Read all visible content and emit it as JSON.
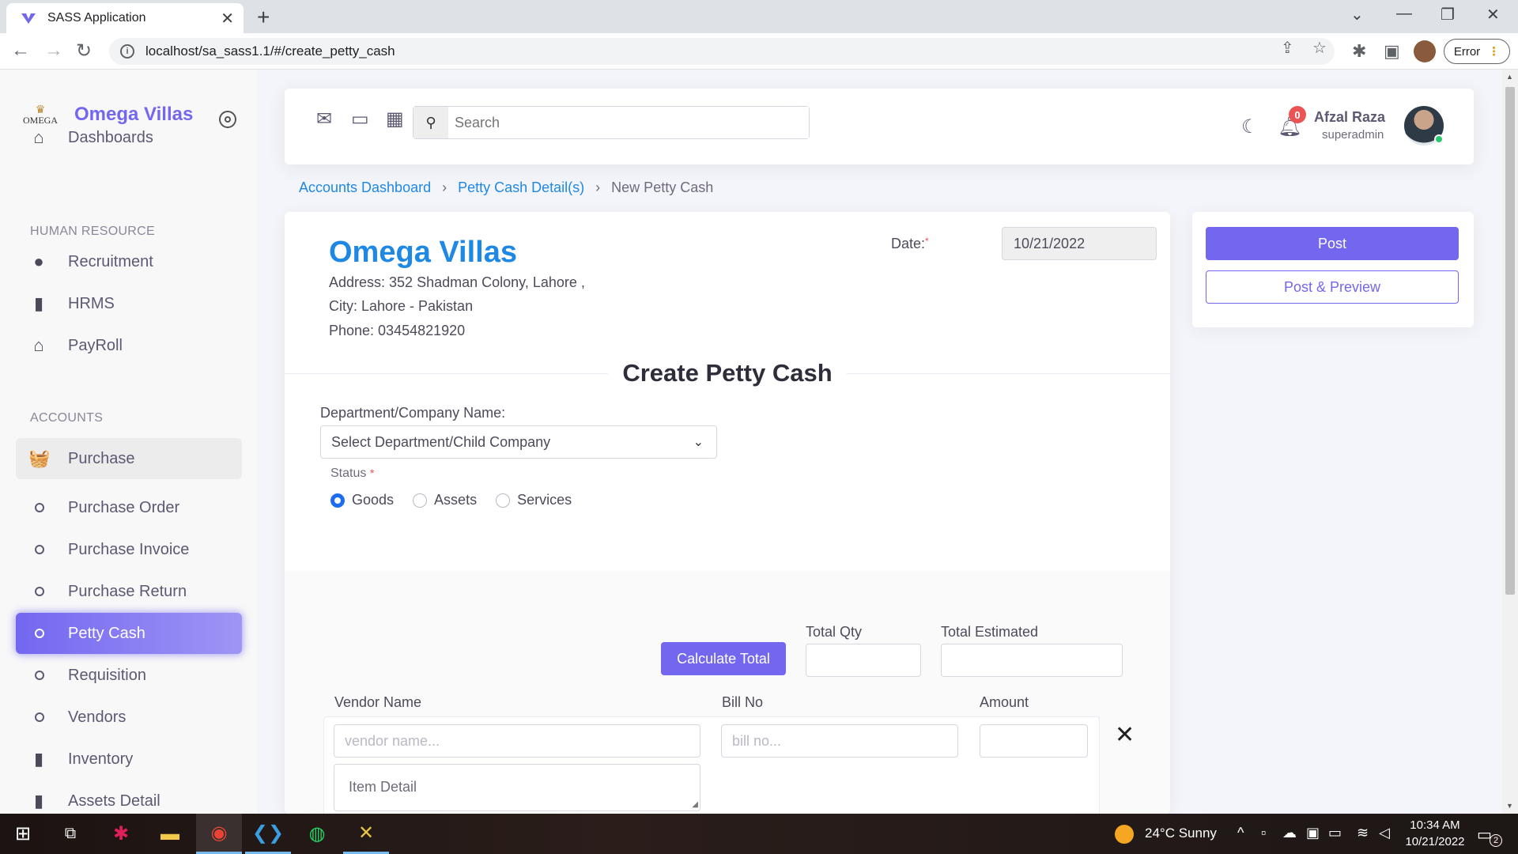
{
  "browser": {
    "tab_title": "SASS Application",
    "tab_close": "✕",
    "new_tab": "+",
    "url": "localhost/sa_sass1.1/#/create_petty_cash",
    "error_label": "Error",
    "minimize": "—",
    "maximize": "❐",
    "close": "✕",
    "tab_menu": "⌄"
  },
  "sidebar": {
    "brand_logo_text": "OMEGA",
    "brand_name": "Omega Villas",
    "dashboards": "Dashboards",
    "hr_header": "HUMAN RESOURCE",
    "hr_items": [
      {
        "label": "Recruitment",
        "icon": "user-icon"
      },
      {
        "label": "HRMS",
        "icon": "file-icon"
      },
      {
        "label": "PayRoll",
        "icon": "bank-icon"
      }
    ],
    "accounts_header": "ACCOUNTS",
    "purchase": "Purchase",
    "sub_items": [
      "Purchase Order",
      "Purchase Invoice",
      "Purchase Return",
      "Petty Cash",
      "Requisition",
      "Vendors"
    ],
    "inventory": "Inventory",
    "assets_detail": "Assets Detail",
    "active_item": "Petty Cash"
  },
  "topnav": {
    "search_placeholder": "Search",
    "notification_count": "0",
    "user_name": "Afzal Raza",
    "user_role": "superadmin"
  },
  "breadcrumb": {
    "items": [
      "Accounts Dashboard",
      "Petty Cash Detail(s)"
    ],
    "current": "New Petty Cash",
    "separator": "›"
  },
  "company": {
    "name": "Omega Villas",
    "address": "Address: 352 Shadman Colony, Lahore ,",
    "city": "City: Lahore - Pakistan",
    "phone": "Phone: 03454821920"
  },
  "form": {
    "date_label": "Date:",
    "date_required": "*",
    "date_value": "10/21/2022",
    "title": "Create Petty Cash",
    "dept_label": "Department/Company Name:",
    "dept_selected": "Select Department/Child Company",
    "status_label": "Status",
    "status_required": "*",
    "status_options": [
      "Goods",
      "Assets",
      "Services"
    ],
    "status_selected": "Goods",
    "calculate_button": "Calculate Total",
    "total_qty_label": "Total Qty",
    "total_estimated_label": "Total Estimated",
    "total_qty_value": "",
    "total_estimated_value": "",
    "vendor_name_label": "Vendor Name",
    "bill_no_label": "Bill No",
    "amount_label": "Amount",
    "vendor_name_placeholder": "vendor name...",
    "bill_no_placeholder": "bill no...",
    "amount_value": "",
    "item_detail_placeholder": "Item Detail",
    "remove_row": "✕"
  },
  "actions": {
    "post": "Post",
    "post_preview": "Post & Preview"
  },
  "taskbar": {
    "weather": "24°C  Sunny",
    "time": "10:34 AM",
    "date": "10/21/2022",
    "notification_count": "2"
  },
  "colors": {
    "primary": "#7367f0",
    "link": "#1e88e5",
    "danger": "#ea5455",
    "success": "#28c76f"
  }
}
